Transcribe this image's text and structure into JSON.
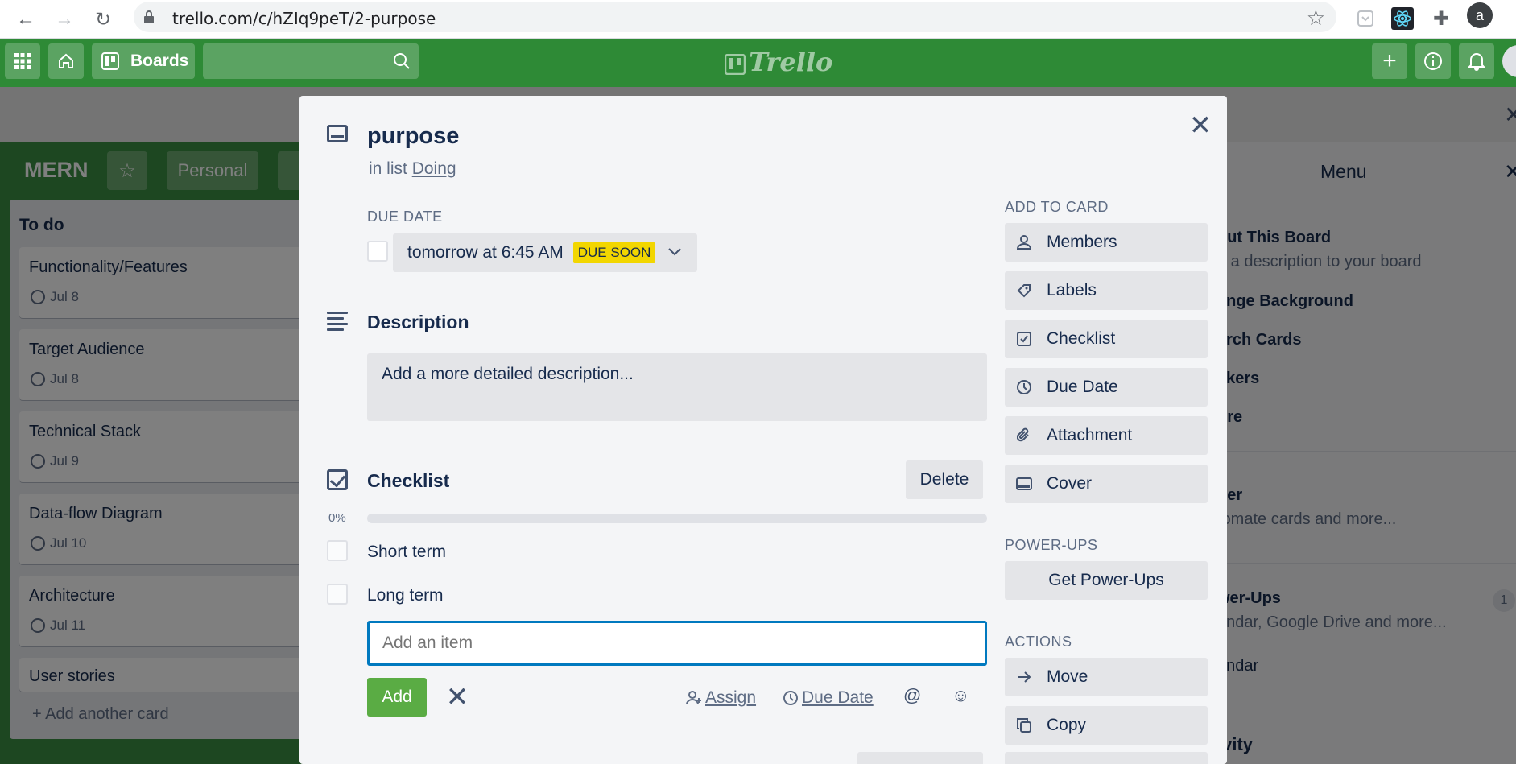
{
  "browser": {
    "url": "trello.com/c/hZIq9peT/2-purpose",
    "avatar_letter": "a"
  },
  "header": {
    "boards_label": "Boards",
    "logo_text": "Trello"
  },
  "board": {
    "title": "MERN",
    "visibility": "Personal",
    "list": {
      "title": "To do",
      "cards": [
        {
          "title": "Functionality/Features",
          "date": "Jul 8"
        },
        {
          "title": "Target Audience",
          "date": "Jul 8"
        },
        {
          "title": "Technical Stack",
          "date": "Jul 9"
        },
        {
          "title": "Data-flow Diagram",
          "date": "Jul 10"
        },
        {
          "title": "Architecture",
          "date": "Jul 11"
        }
      ],
      "partial_card": "User stories",
      "add_card": "+ Add another card"
    }
  },
  "menu": {
    "title": "Menu",
    "items": [
      "out This Board",
      "d a description to your board",
      "ange Background",
      "arch Cards",
      "ckers",
      "ore",
      "tler",
      "tomate cards and more...",
      "wer-Ups",
      "endar, Google Drive and more...",
      "endar",
      "ivity"
    ],
    "badge": "1"
  },
  "card": {
    "title": "purpose",
    "in_list_prefix": "in list",
    "list_name": "Doing",
    "due_label": "DUE DATE",
    "due_text": "tomorrow at 6:45 AM",
    "due_badge": "DUE SOON",
    "description_heading": "Description",
    "description_placeholder": "Add a more detailed description...",
    "checklist_heading": "Checklist",
    "delete_label": "Delete",
    "progress_label": "0%",
    "progress_value": 0,
    "items": [
      "Short term",
      "Long term"
    ],
    "add_item_placeholder": "Add an item",
    "add_label": "Add",
    "assign_label": "Assign",
    "due_date_label": "Due Date"
  },
  "sidebar": {
    "add_to_card_label": "ADD TO CARD",
    "add_to_card": [
      "Members",
      "Labels",
      "Checklist",
      "Due Date",
      "Attachment",
      "Cover"
    ],
    "powerups_label": "POWER-UPS",
    "get_powerups": "Get Power-Ups",
    "actions_label": "ACTIONS",
    "actions": [
      "Move",
      "Copy"
    ]
  },
  "colors": {
    "header_green": "#2e8a36",
    "accent_blue": "#0079bf",
    "add_green": "#5aac44",
    "due_soon_yellow": "#f2d600"
  }
}
